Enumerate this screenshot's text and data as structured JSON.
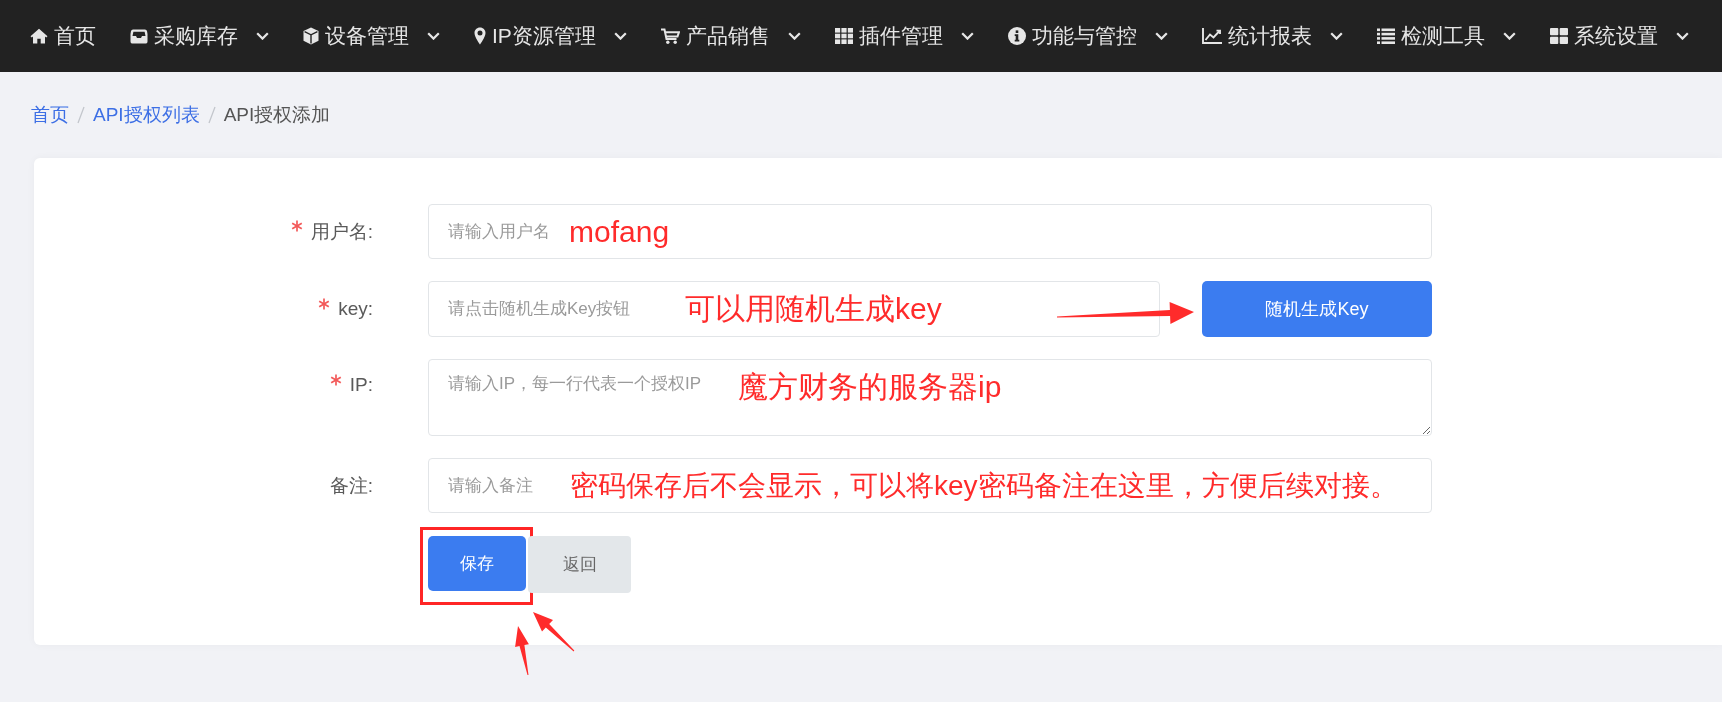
{
  "nav": {
    "items": [
      {
        "label": "首页",
        "dropdown": false
      },
      {
        "label": "采购库存",
        "dropdown": true
      },
      {
        "label": "设备管理",
        "dropdown": true
      },
      {
        "label": "IP资源管理",
        "dropdown": true
      },
      {
        "label": "产品销售",
        "dropdown": true
      },
      {
        "label": "插件管理",
        "dropdown": true
      },
      {
        "label": "功能与管控",
        "dropdown": true
      },
      {
        "label": "统计报表",
        "dropdown": true
      },
      {
        "label": "检测工具",
        "dropdown": true
      },
      {
        "label": "系统设置",
        "dropdown": true
      }
    ]
  },
  "breadcrumb": {
    "items": [
      {
        "label": "首页",
        "kind": "link"
      },
      {
        "label": "API授权列表",
        "kind": "link"
      },
      {
        "label": "API授权添加",
        "kind": "current"
      }
    ]
  },
  "form": {
    "fields": [
      {
        "kind": "input",
        "label": "用户名:",
        "required": true,
        "placeholder": "请输入用户名",
        "annotation": "mofang"
      },
      {
        "kind": "input",
        "label": "key:",
        "required": true,
        "placeholder": "请点击随机生成Key按钮",
        "button": "随机生成Key",
        "annotation": "可以用随机生成key"
      },
      {
        "kind": "textarea",
        "label": "IP:",
        "required": true,
        "placeholder": "请输入IP，每一行代表一个授权IP",
        "annotation": "魔方财务的服务器ip"
      },
      {
        "kind": "input",
        "label": "备注:",
        "required": false,
        "placeholder": "请输入备注",
        "annotation": "密码保存后不会显示，可以将key密码备注在这里，方便后续对接。"
      }
    ],
    "buttons": [
      {
        "label": "保存",
        "kind": "primary",
        "highlighted": true
      },
      {
        "label": "返回",
        "kind": "secondary",
        "highlighted": false
      }
    ]
  }
}
